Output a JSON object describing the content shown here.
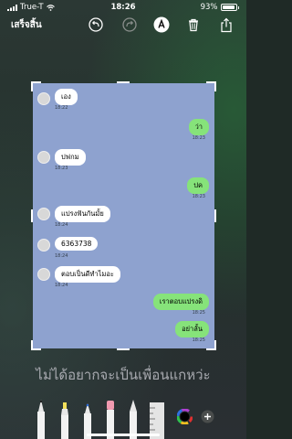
{
  "status": {
    "carrier": "True-T",
    "time": "18:26",
    "battery": "93%"
  },
  "toolbar": {
    "done_label": "เสร็จสิ้น"
  },
  "messages": [
    {
      "side": "left",
      "text": "เอง",
      "time": "18:22"
    },
    {
      "side": "right",
      "text": "ว่า",
      "time": "18:23"
    },
    {
      "side": "left",
      "text": "ปฟกม",
      "time": "18:23"
    },
    {
      "side": "right",
      "text": "ปค",
      "time": "18:23"
    },
    {
      "side": "left",
      "text": "แปรงฟันกันมั้ย",
      "time": "18:24"
    },
    {
      "side": "left",
      "text": "6363738",
      "time": "18:24"
    },
    {
      "side": "left",
      "text": "ตอบเป็นดีทำไมอะ",
      "time": "18:24"
    },
    {
      "side": "right",
      "text": "เราตอบแปรงดิ",
      "time": "18:25"
    },
    {
      "side": "right",
      "text": "อย่าลั้น",
      "time": "18:25"
    }
  ],
  "caption": "ไม่ได้อยากจะเป็นเพื่อนแกหว่ะ",
  "tools": [
    "pen",
    "highlighter",
    "marker",
    "eraser",
    "lasso",
    "ruler",
    "color-picker",
    "add"
  ]
}
